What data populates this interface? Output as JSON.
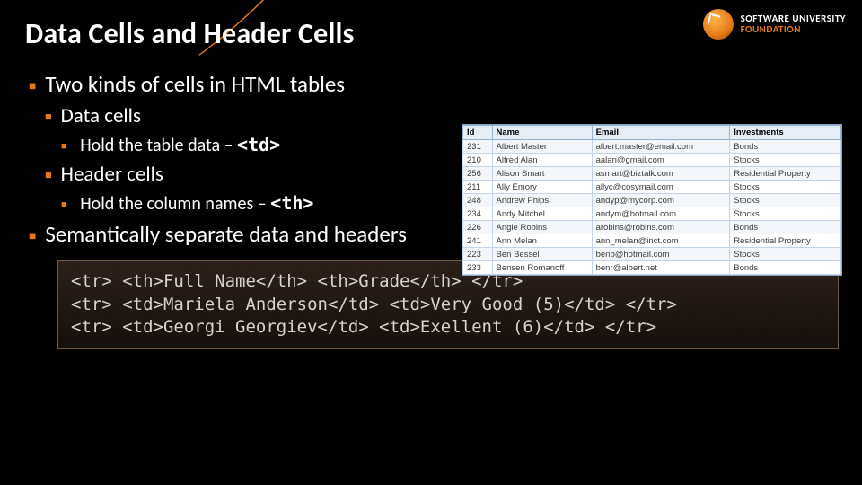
{
  "logo": {
    "l1": "SOFTWARE UNIVERSITY",
    "l2": "FOUNDATION"
  },
  "title": "Data Cells and Header Cells",
  "bullets": {
    "l1a": "Two kinds of cells in HTML tables",
    "l2a": "Data cells",
    "l3a_pre": "Hold the table data – ",
    "l3a_code": "<td>",
    "l2b": "Header cells",
    "l3b_pre": "Hold the column names – ",
    "l3b_code": "<th>",
    "l1b": "Semantically separate data and headers"
  },
  "code": {
    "line1": "<tr> <th>Full Name</th> <th>Grade</th> </tr>",
    "line2": "<tr> <td>Mariela Anderson</td> <td>Very Good (5)</td> </tr>",
    "line3": "<tr> <td>Georgi Georgiev</td> <td>Exellent (6)</td> </tr>"
  },
  "mini_table": {
    "headers": [
      "Id",
      "Name",
      "Email",
      "Investments"
    ],
    "rows": [
      [
        "231",
        "Albert Master",
        "albert.master@email.com",
        "Bonds"
      ],
      [
        "210",
        "Alfred Alan",
        "aalan@gmail.com",
        "Stocks"
      ],
      [
        "256",
        "Alison Smart",
        "asmart@biztalk.com",
        "Residential Property"
      ],
      [
        "211",
        "Ally Emory",
        "allyc@cosymail.com",
        "Stocks"
      ],
      [
        "248",
        "Andrew Phips",
        "andyp@mycorp.com",
        "Stocks"
      ],
      [
        "234",
        "Andy Mitchel",
        "andym@hotmail.com",
        "Stocks"
      ],
      [
        "226",
        "Angie Robins",
        "arobins@robins.com",
        "Bonds"
      ],
      [
        "241",
        "Ann Melan",
        "ann_melan@inct.com",
        "Residential Property"
      ],
      [
        "223",
        "Ben Bessel",
        "benb@hotmail.com",
        "Stocks"
      ],
      [
        "233",
        "Bensen Romanoff",
        "benr@albert.net",
        "Bonds"
      ]
    ]
  }
}
